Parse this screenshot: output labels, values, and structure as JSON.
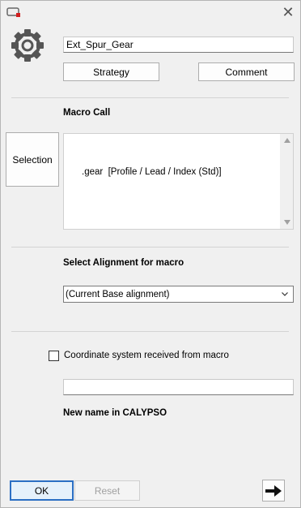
{
  "window": {
    "close_symbol": "✕"
  },
  "header": {
    "name_value": "Ext_Spur_Gear",
    "strategy_label": "Strategy",
    "comment_label": "Comment"
  },
  "macro": {
    "section_label": "Macro Call",
    "selection_label": "Selection",
    "call_text": ".gear  [Profile / Lead / Index (Std)]"
  },
  "alignment": {
    "section_label": "Select Alignment for macro",
    "selected_value": "(Current Base alignment)"
  },
  "coordinate": {
    "checkbox_label": "Coordinate system received from macro",
    "checked": false,
    "new_name_value": "",
    "new_name_label": "New name in CALYPSO"
  },
  "footer": {
    "ok_label": "OK",
    "reset_label": "Reset"
  },
  "icons": {
    "app": "app-icon",
    "gear": "gear-icon",
    "close": "close-icon",
    "chevron": "chevron-down-icon",
    "next": "arrow-right-icon"
  },
  "colors": {
    "background": "#f0f0f0",
    "focus_border": "#2b6fc4",
    "app_icon_red": "#d21f1f"
  }
}
